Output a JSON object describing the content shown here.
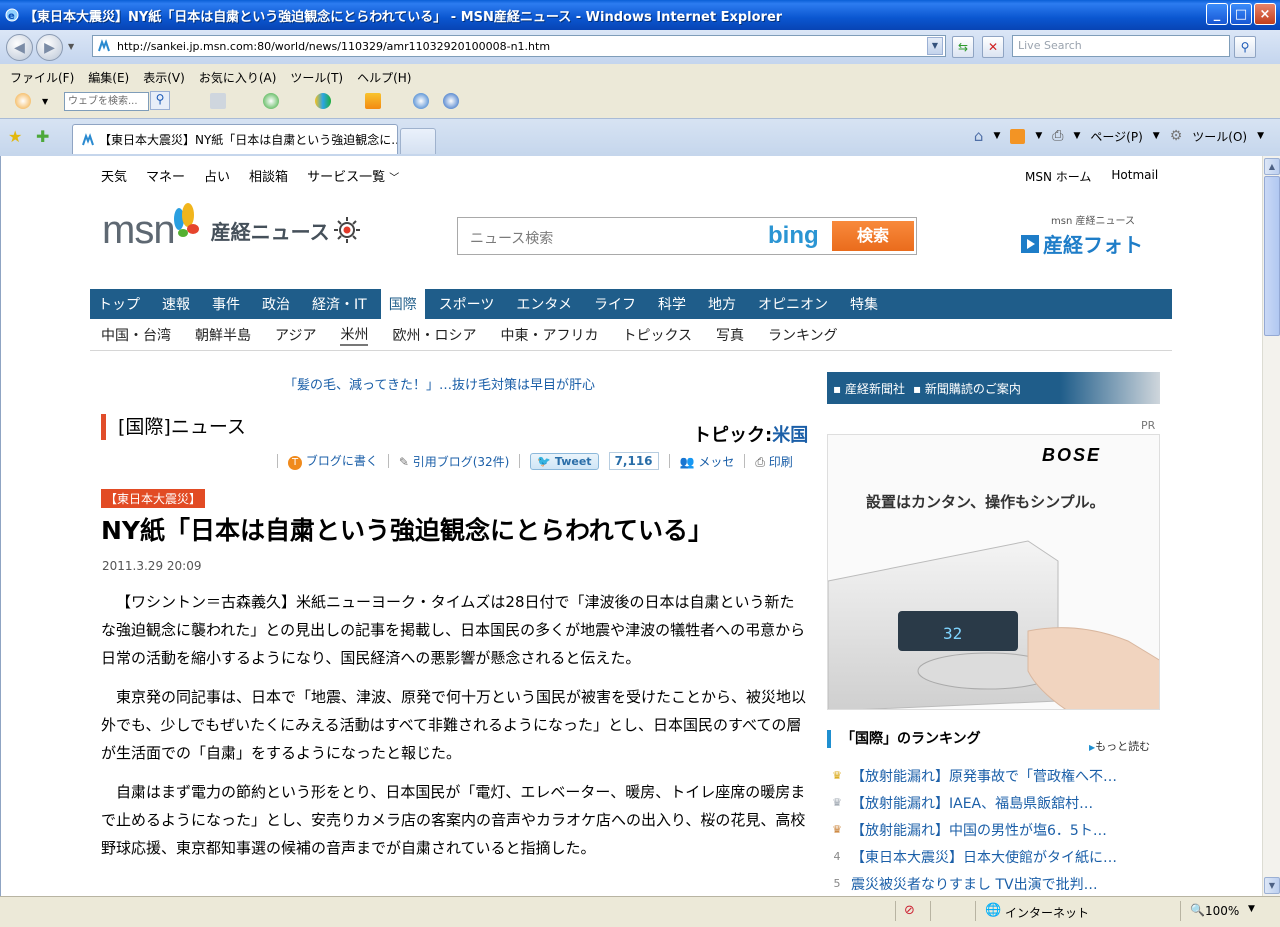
{
  "window": {
    "title": "【東日本大震災】NY紙「日本は自粛という強迫観念にとらわれている」 - MSN産経ニュース - Windows Internet Explorer",
    "minimize": "_",
    "maximize": "□",
    "close": "×"
  },
  "address": {
    "url": "http://sankei.jp.msn.com:80/world/news/110329/amr11032920100008-n1.htm",
    "search_placeholder": "Live Search"
  },
  "menu": [
    "ファイル(F)",
    "編集(E)",
    "表示(V)",
    "お気に入り(A)",
    "ツール(T)",
    "ヘルプ(H)"
  ],
  "toolbar": {
    "web_search_placeholder": "ウェブを検索..."
  },
  "tab": {
    "title": "【東日本大震災】NY紙「日本は自粛という強迫観念に..."
  },
  "command_bar": {
    "page": "ページ(P)",
    "tools": "ツール(O)"
  },
  "status": {
    "zone": "インターネット",
    "zoom": "100%"
  },
  "site": {
    "util_links": [
      "天気",
      "マネー",
      "占い",
      "相談箱",
      "サービス一覧"
    ],
    "util_right": [
      "MSN ホーム",
      "Hotmail"
    ],
    "logo_msn": "msn",
    "logo_sankei": "産経ニュース",
    "search_placeholder": "ニュース検索",
    "bing": "bing",
    "search_button": "検索",
    "photo_small": "msn 産経ニュース",
    "photo_big": "産経フォト",
    "main_nav": [
      "トップ",
      "速報",
      "事件",
      "政治",
      "経済・IT",
      "国際",
      "スポーツ",
      "エンタメ",
      "ライフ",
      "科学",
      "地方",
      "オピニオン",
      "特集"
    ],
    "main_nav_active": "国際",
    "sub_nav": [
      "中国・台湾",
      "朝鮮半島",
      "アジア",
      "米州",
      "欧州・ロシア",
      "中東・アフリカ",
      "トピックス",
      "写真",
      "ランキング"
    ],
    "sub_nav_active": "米州"
  },
  "article": {
    "promo": "「髪の毛、減ってきた！」…抜け毛対策は早目が肝心",
    "section_title": "[国際]ニュース",
    "topic_label": "トピック:",
    "topic_value": "米国",
    "tools": {
      "blog": "ブログに書く",
      "trackback": "引用ブログ(32件)",
      "tweet": "Tweet",
      "tweet_count": "7,116",
      "messe": "メッセ",
      "print": "印刷"
    },
    "badge": "【東日本大震災】",
    "headline": "NY紙「日本は自粛という強迫観念にとらわれている」",
    "date": "2011.3.29 20:09",
    "paragraphs": [
      "【ワシントン＝古森義久】米紙ニューヨーク・タイムズは28日付で「津波後の日本は自粛という新たな強迫観念に襲われた」との見出しの記事を掲載し、日本国民の多くが地震や津波の犠牲者への弔意から日常の活動を縮小するようになり、国民経済への悪影響が懸念されると伝えた。",
      "東京発の同記事は、日本で「地震、津波、原発で何十万という国民が被害を受けたことから、被災地以外でも、少しでもぜいたくにみえる活動はすべて非難されるようになった」とし、日本国民のすべての層が生活面での「自粛」をするようになったと報じた。",
      "自粛はまず電力の節約という形をとり、日本国民が「電灯、エレベーター、暖房、トイレ座席の暖房まで止めるようになった」とし、安売りカメラ店の客案内の音声やカラオケ店への出入り、桜の花見、高校野球応援、東京都知事選の候補の音声までが自粛されていると指摘した。"
    ]
  },
  "sidebar": {
    "banner_items": [
      "産経新聞社",
      "新聞購読のご案内"
    ],
    "pr": "PR",
    "ad_brand": "BOSE",
    "ad_copy": "設置はカンタン、操作もシンプル。",
    "ad_display": "32",
    "ranking_title": "「国際」のランキング",
    "ranking_more": "もっと読む",
    "ranking": [
      {
        "rank": "1",
        "text": "【放射能漏れ】原発事故で「菅政権へ不…"
      },
      {
        "rank": "2",
        "text": "【放射能漏れ】IAEA、福島県飯舘村…"
      },
      {
        "rank": "3",
        "text": "【放射能漏れ】中国の男性が塩6．5ト…"
      },
      {
        "rank": "4",
        "text": "【東日本大震災】日本大使館がタイ紙に…"
      },
      {
        "rank": "5",
        "text": "震災被災者なりすまし TV出演で批判…"
      }
    ]
  },
  "colors": {
    "nav_blue": "#1f5d8a",
    "link_blue": "#1b5fa8",
    "badge_red": "#e24b24",
    "search_orange": "#f07a2a"
  }
}
